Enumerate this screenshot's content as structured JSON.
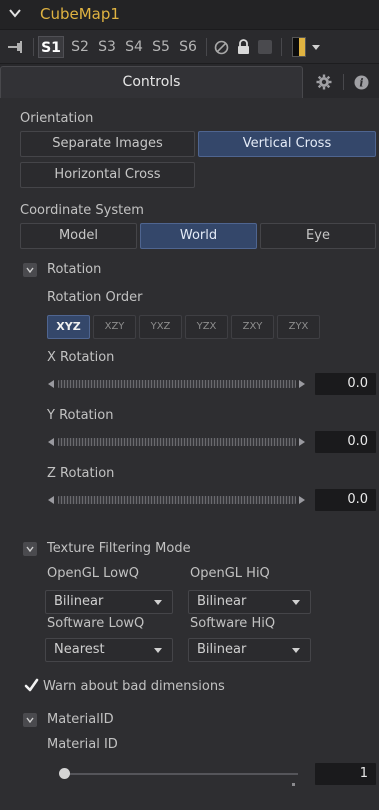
{
  "header": {
    "title": "CubeMap1"
  },
  "toolbar": {
    "scenes": [
      "S1",
      "S2",
      "S3",
      "S4",
      "S5",
      "S6"
    ]
  },
  "tabs": {
    "controls": "Controls"
  },
  "orientation": {
    "label": "Orientation",
    "options": [
      "Separate Images",
      "Vertical Cross",
      "Horizontal Cross"
    ],
    "selected": "Vertical Cross"
  },
  "coordinate_system": {
    "label": "Coordinate System",
    "options": [
      "Model",
      "World",
      "Eye"
    ],
    "selected": "World"
  },
  "rotation": {
    "section_label": "Rotation",
    "order_label": "Rotation Order",
    "orders": [
      "XYZ",
      "XZY",
      "YXZ",
      "YZX",
      "ZXY",
      "ZYX"
    ],
    "selected_order": "XYZ",
    "x_label": "X Rotation",
    "x_value": "0.0",
    "y_label": "Y Rotation",
    "y_value": "0.0",
    "z_label": "Z Rotation",
    "z_value": "0.0"
  },
  "texture": {
    "section_label": "Texture Filtering Mode",
    "opengl_lowq_label": "OpenGL LowQ",
    "opengl_lowq_value": "Bilinear",
    "opengl_hiq_label": "OpenGL HiQ",
    "opengl_hiq_value": "Bilinear",
    "software_lowq_label": "Software LowQ",
    "software_lowq_value": "Nearest",
    "software_hiq_label": "Software HiQ",
    "software_hiq_value": "Bilinear"
  },
  "warn": {
    "label": "Warn about bad dimensions",
    "checked": true
  },
  "material": {
    "section_label": "MaterialID",
    "id_label": "Material ID",
    "id_value": "1"
  },
  "colors": {
    "accent": "#e0b341",
    "selected": "#34476a"
  },
  "icons": [
    "chevron-down-icon",
    "pin-icon",
    "disable-icon",
    "lock-icon",
    "gear-icon",
    "info-icon",
    "checkmark-icon"
  ]
}
